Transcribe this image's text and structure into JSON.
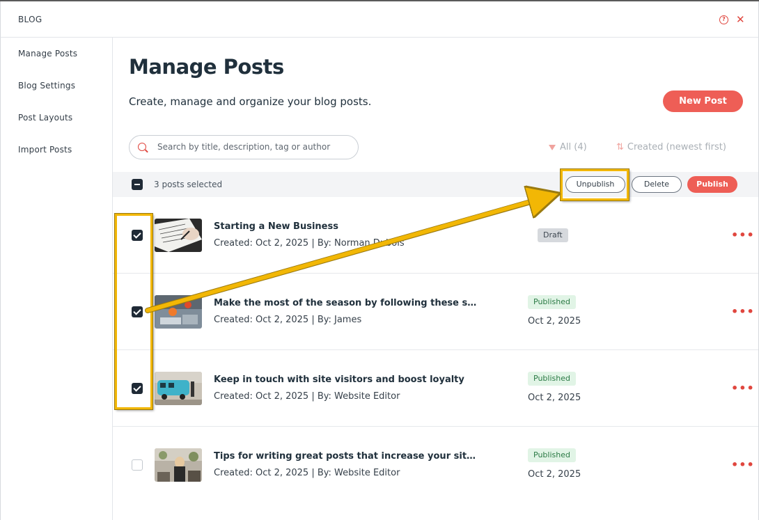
{
  "header": {
    "title": "BLOG",
    "help_icon": "question-circle-icon",
    "close_icon": "close-icon"
  },
  "sidebar": {
    "items": [
      {
        "label": "Manage Posts"
      },
      {
        "label": "Blog Settings"
      },
      {
        "label": "Post Layouts"
      },
      {
        "label": "Import Posts"
      }
    ]
  },
  "main": {
    "title": "Manage Posts",
    "subtitle": "Create, manage and organize your blog posts.",
    "new_post_label": "New Post",
    "search": {
      "placeholder": "Search by title, description, tag or author",
      "value": ""
    },
    "filter_label": "All (4)",
    "sort_label": "Created (newest first)",
    "bulk": {
      "selected_text": "3 posts selected",
      "unpublish_label": "Unpublish",
      "delete_label": "Delete",
      "publish_label": "Publish"
    },
    "posts": [
      {
        "title": "Starting a New Business",
        "meta": "Created: Oct 2, 2025 | By: Norman Dubois",
        "status": "Draft",
        "date": "",
        "checked": true
      },
      {
        "title": "Make the most of the season by following these simple …",
        "meta": "Created: Oct 2, 2025 | By: James",
        "status": "Published",
        "date": "Oct 2, 2025",
        "checked": true
      },
      {
        "title": "Keep in touch with site visitors and boost loyalty",
        "meta": "Created: Oct 2, 2025 | By: Website Editor",
        "status": "Published",
        "date": "Oct 2, 2025",
        "checked": true
      },
      {
        "title": "Tips for writing great posts that increase your site traffic",
        "meta": "Created: Oct 2, 2025 | By: Website Editor",
        "status": "Published",
        "date": "Oct 2, 2025",
        "checked": false
      }
    ],
    "more_label": "•••"
  },
  "colors": {
    "accent": "#ee5e56",
    "highlight": "#f2b705",
    "published_bg": "#e1f4e6",
    "draft_bg": "#d6d9dd"
  }
}
